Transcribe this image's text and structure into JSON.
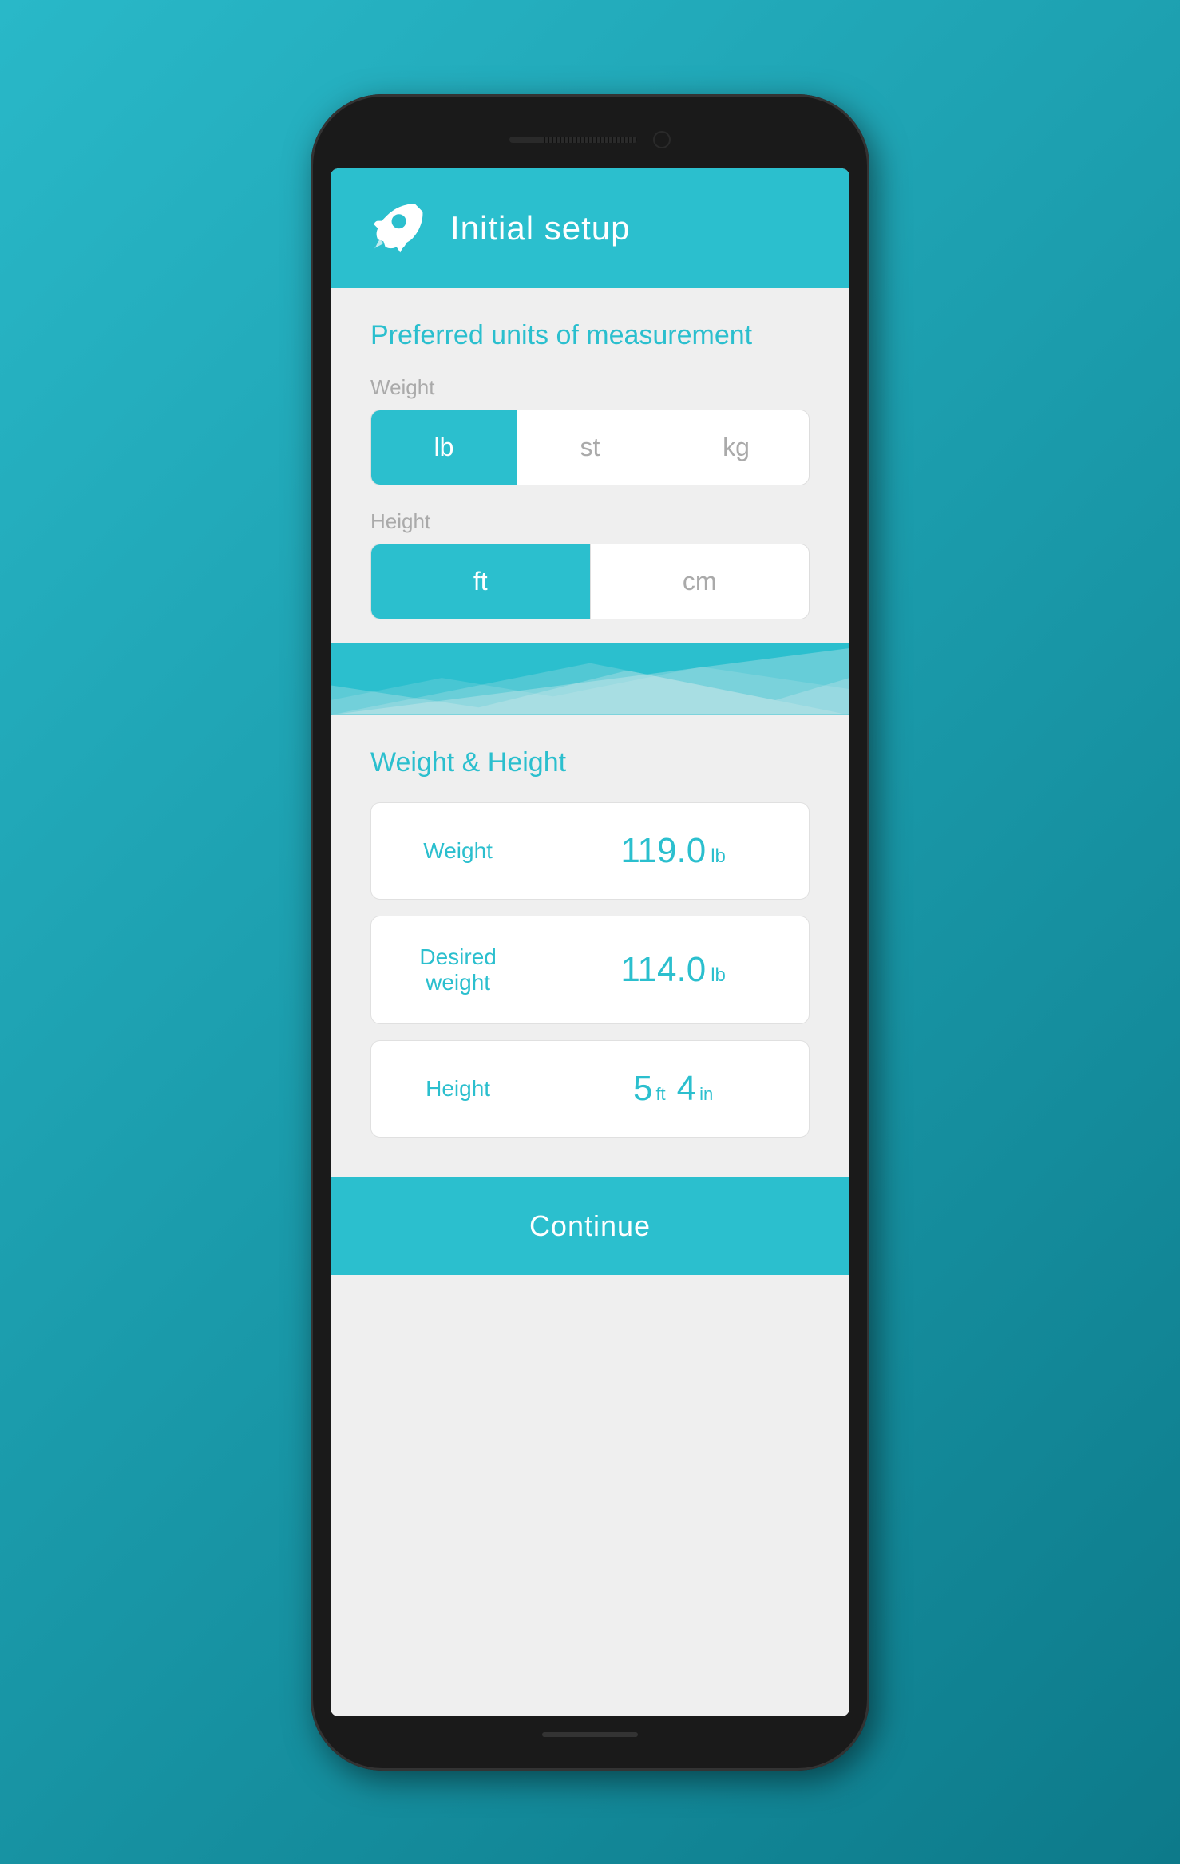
{
  "header": {
    "title": "Initial setup",
    "icon": "rocket-icon"
  },
  "section1": {
    "title": "Preferred units of measurement",
    "weight_label": "Weight",
    "weight_options": [
      {
        "label": "lb",
        "active": true
      },
      {
        "label": "st",
        "active": false
      },
      {
        "label": "kg",
        "active": false
      }
    ],
    "height_label": "Height",
    "height_options": [
      {
        "label": "ft",
        "active": true
      },
      {
        "label": "cm",
        "active": false
      }
    ]
  },
  "section2": {
    "title": "Weight & Height",
    "rows": [
      {
        "label": "Weight",
        "value": "119.0",
        "unit": "lb"
      },
      {
        "label": "Desired weight",
        "value": "114.0",
        "unit": "lb"
      },
      {
        "label": "Height",
        "feet": "5",
        "ft_unit": "ft",
        "inches": "4",
        "in_unit": "in"
      }
    ]
  },
  "footer": {
    "continue_label": "Continue"
  }
}
